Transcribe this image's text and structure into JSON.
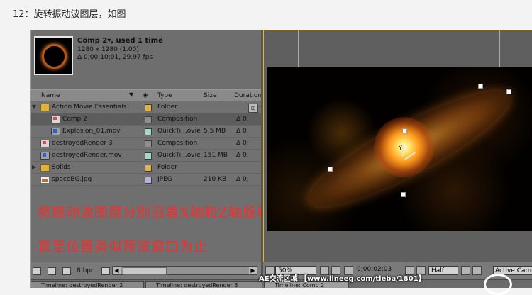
{
  "heading": "12：旋转振动波图层，如图",
  "info": {
    "comp_name": "Comp 2▾, used 1 time",
    "resolution": "1280 x 1280 (1.00)",
    "timing": "Δ 0;00;10;01, 29.97 fps"
  },
  "columns": {
    "name": "Name",
    "type": "Type",
    "size": "Size",
    "duration": "Duration"
  },
  "items": [
    {
      "name": "Action Movie Essentials",
      "type": "Folder",
      "size": "",
      "duration": "",
      "icon": "folder-icon",
      "label": "#e3b13e"
    },
    {
      "name": "Comp 2",
      "type": "Composition",
      "size": "",
      "duration": "Δ 0;",
      "icon": "composition-icon",
      "label": "#8f8f8f"
    },
    {
      "name": "Explosion_01.mov",
      "type": "QuickTi...ovie",
      "size": "5.5 MB",
      "duration": "Δ 0;",
      "icon": "movie-file-icon",
      "label": "#a6d8c9"
    },
    {
      "name": "destroyedRender 3",
      "type": "Composition",
      "size": "",
      "duration": "Δ 0;",
      "icon": "composition-icon",
      "label": "#8f8f8f"
    },
    {
      "name": "destroyedRender.mov",
      "type": "QuickTi...ovie",
      "size": "151 MB",
      "duration": "Δ 0;",
      "icon": "movie-file-icon",
      "label": "#a6d8c9"
    },
    {
      "name": "Solids",
      "type": "Folder",
      "size": "",
      "duration": "",
      "icon": "folder-icon",
      "label": "#e3b13e"
    },
    {
      "name": "spaceBG.jpg",
      "type": "JPEG",
      "size": "210 KB",
      "duration": "Δ 0;",
      "icon": "image-file-icon",
      "label": "#b8b0e0"
    }
  ],
  "annotation": {
    "line1": "将振动波图层分别沿着X轴和Z轴旋转",
    "line2": "直至位置类似预览窗口为止"
  },
  "project_footer": {
    "bit_depth": "8 bpc"
  },
  "viewer_controls": {
    "zoom": "50%",
    "timecode": "0;00;02:03",
    "resolution": "Half",
    "camera": "Active Camera"
  },
  "axis_label": "Y",
  "tabs": [
    "Timeline: destroyedRender 2",
    "Timeline: destroyedRender 3",
    "Timeline: Comp 2"
  ],
  "watermark": "AE交流区域  【www.lineeg.com/tieba/1801】",
  "colors": {
    "annotation": "#ff2a2a",
    "viewer_border": "#e6b82f"
  }
}
